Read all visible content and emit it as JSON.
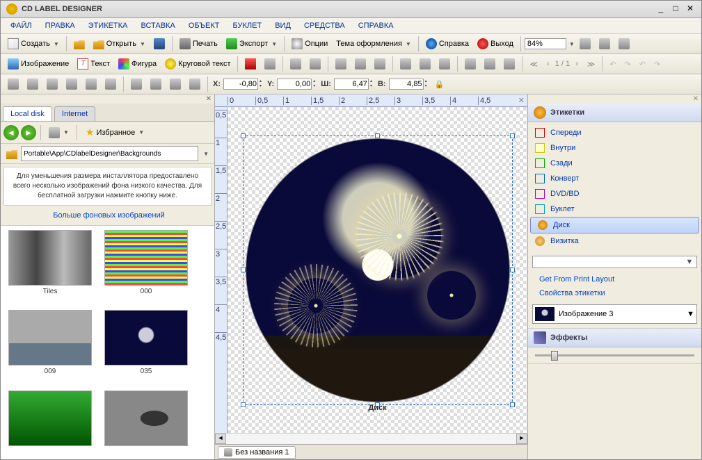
{
  "window": {
    "title": "CD LABEL DESIGNER"
  },
  "menu": [
    "ФАЙЛ",
    "ПРАВКА",
    "ЭТИКЕТКА",
    "ВСТАВКА",
    "ОБЪЕКТ",
    "БУКЛЕТ",
    "ВИД",
    "СРЕДСТВА",
    "СПРАВКА"
  ],
  "toolbar1": {
    "create": "Создать",
    "open": "Открыть",
    "print": "Печать",
    "export": "Экспорт",
    "options": "Опции",
    "theme": "Тема оформления",
    "help": "Справка",
    "exit": "Выход",
    "zoom": "84%"
  },
  "toolbar2": {
    "image": "Изображение",
    "text": "Текст",
    "shape": "Фигура",
    "circtext": "Круговой текст",
    "page": "1 / 1"
  },
  "coords": {
    "x_label": "X:",
    "x": "-0,80",
    "y_label": "Y:",
    "y": "0,00",
    "w_label": "Ш:",
    "w": "6,47",
    "h_label": "B:",
    "h": "4,85"
  },
  "left": {
    "tab_local": "Local disk",
    "tab_internet": "Internet",
    "favorites": "Избранное",
    "path": "Portable\\App\\CDlabelDesigner\\Backgrounds",
    "info": "Для уменьшения размера инсталлятора предоставлено всего несколько изображений фона низкого качества. Для бесплатной загрузки нажмите кнопку ниже.",
    "more": "Больше фоновых изображений",
    "thumbs": [
      "Tiles",
      "000",
      "009",
      "035"
    ]
  },
  "ruler_h": [
    "0",
    "0,5",
    "1",
    "1,5",
    "2",
    "2,5",
    "3",
    "3,5",
    "4",
    "4,5"
  ],
  "ruler_v": [
    "0,5",
    "1",
    "1,5",
    "2",
    "2,5",
    "3",
    "3,5",
    "4",
    "4,5"
  ],
  "canvas": {
    "label": "Диск"
  },
  "doc_tab": "Без названия 1",
  "right": {
    "labels_header": "Этикетки",
    "items": [
      {
        "label": "Спереди",
        "cls": "sq-red"
      },
      {
        "label": "Внутри",
        "cls": "sq-yellow"
      },
      {
        "label": "Сзади",
        "cls": "sq-green"
      },
      {
        "label": "Конверт",
        "cls": "sq-blue"
      },
      {
        "label": "DVD/BD",
        "cls": "sq-purple"
      },
      {
        "label": "Буклет",
        "cls": "sq-teal"
      }
    ],
    "disk": "Диск",
    "card": "Визитка",
    "get_print": "Get From Print Layout",
    "props": "Свойства этикетки",
    "obj": "Изображение 3",
    "effects": "Эффекты"
  }
}
